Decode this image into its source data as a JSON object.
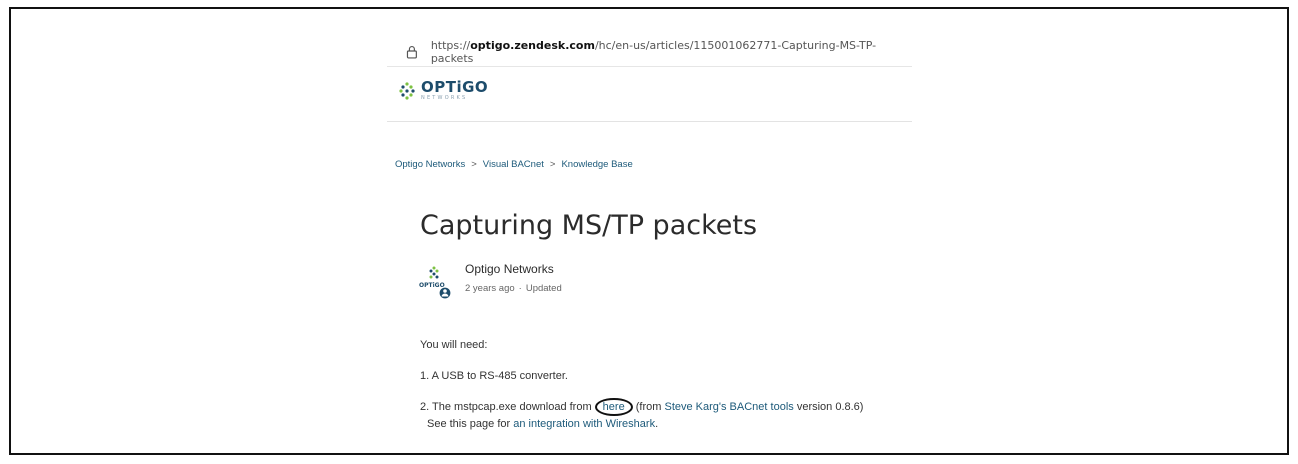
{
  "browser": {
    "url_prefix": "https://",
    "url_domain": "optigo.zendesk.com",
    "url_path": "/hc/en-us/articles/115001062771-Capturing-MS-TP-packets"
  },
  "brand": {
    "name": "OPTiGO",
    "subtitle": "NETWORKS",
    "colors": {
      "primary": "#1d4c6b",
      "accent": "#7dc242",
      "link": "#1d5a7a"
    }
  },
  "breadcrumb": {
    "items": [
      "Optigo Networks",
      "Visual BACnet",
      "Knowledge Base"
    ],
    "separator": ">"
  },
  "article": {
    "title": "Capturing MS/TP packets",
    "author": "Optigo Networks",
    "age": "2 years ago",
    "updated": "Updated",
    "intro": "You will need:",
    "item1": "1. A USB to RS-485 converter.",
    "item2_prefix": "2. The mstpcap.exe download from ",
    "item2_link_here": "here",
    "item2_mid": " (from ",
    "item2_link_tools": "Steve Karg's BACnet tools",
    "item2_suffix": " version 0.8.6)",
    "item3_prefix": "See this page for ",
    "item3_link": "an integration with Wireshark",
    "item3_suffix": "."
  }
}
